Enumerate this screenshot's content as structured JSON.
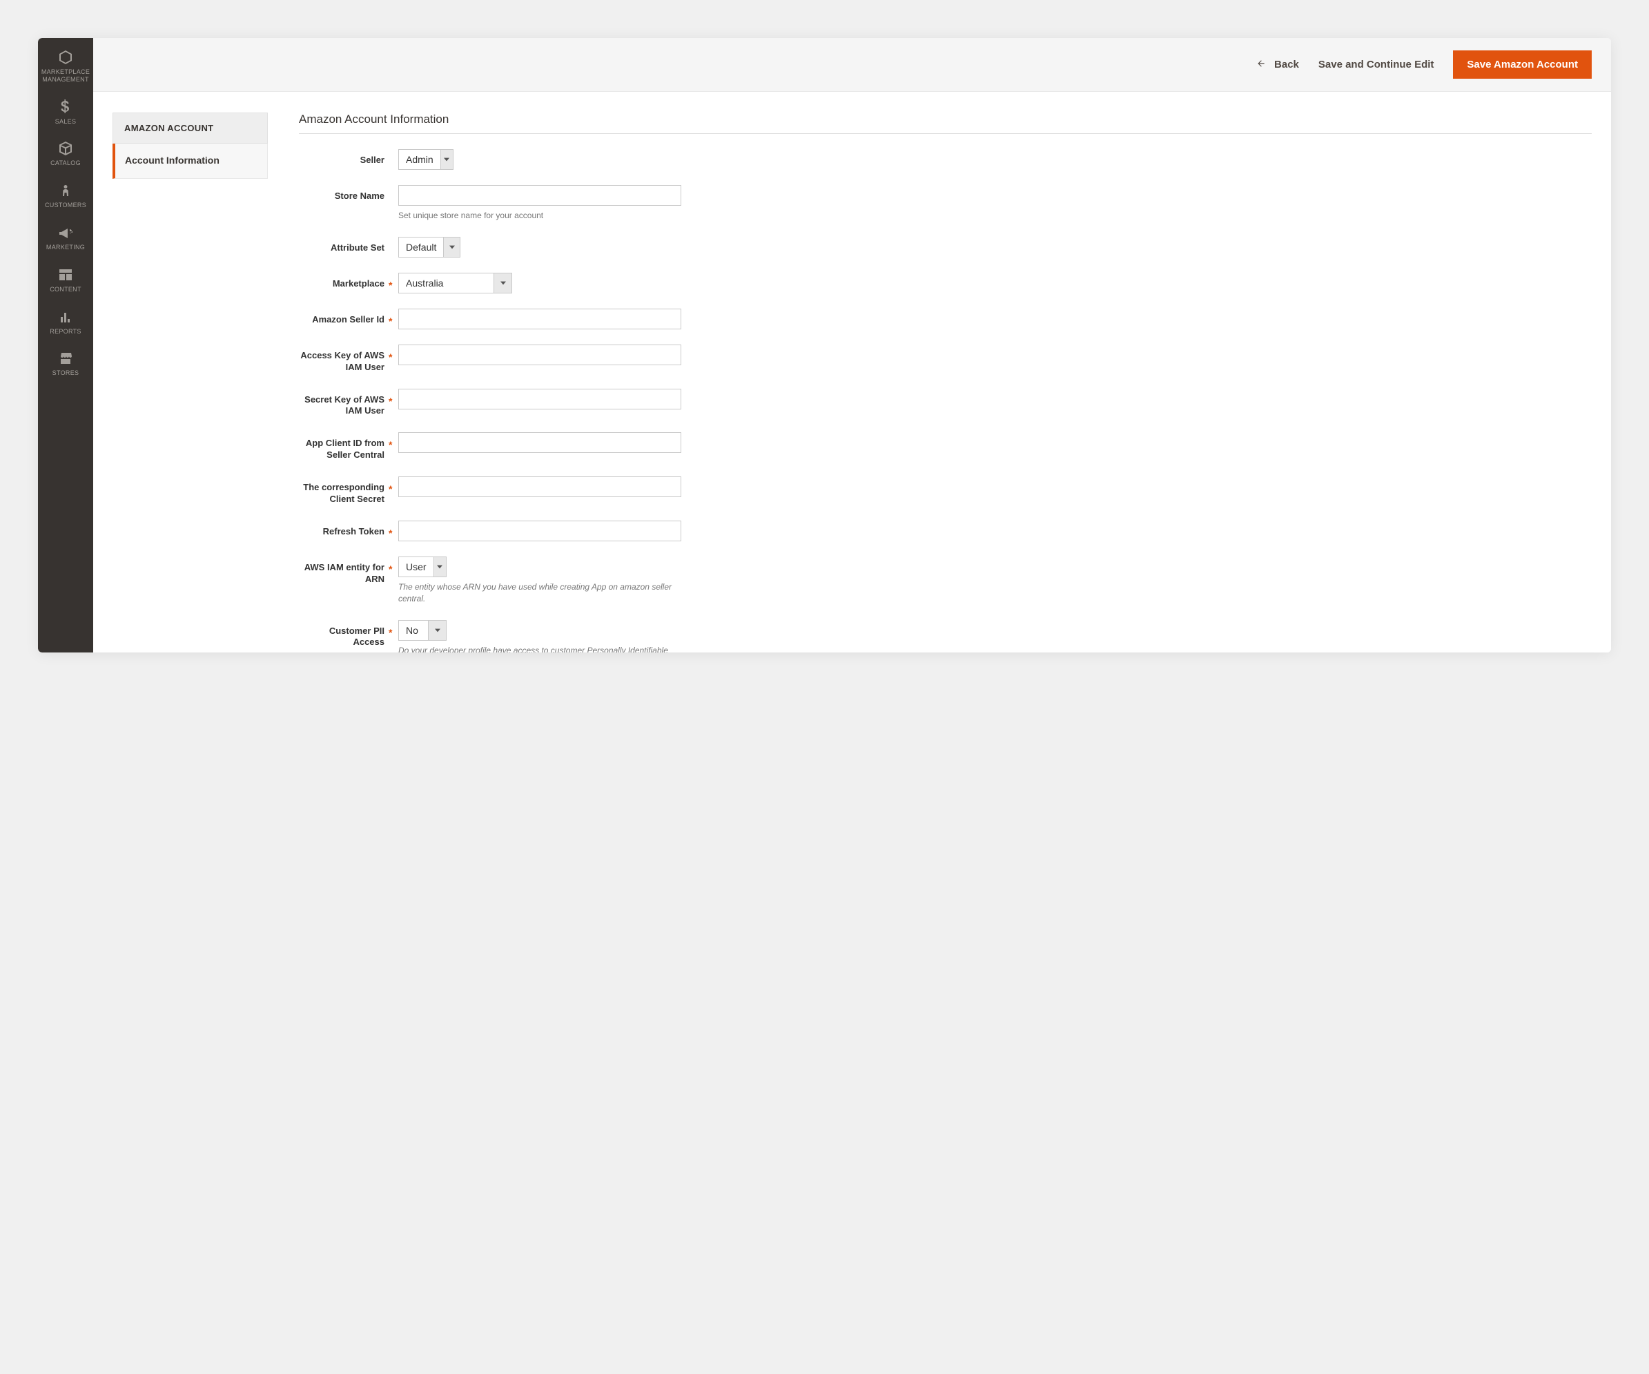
{
  "sidebar": {
    "items": [
      {
        "label": "MARKETPLACE MANAGEMENT",
        "icon": "hexagon-icon"
      },
      {
        "label": "SALES",
        "icon": "dollar-icon"
      },
      {
        "label": "CATALOG",
        "icon": "box-icon"
      },
      {
        "label": "CUSTOMERS",
        "icon": "person-icon"
      },
      {
        "label": "MARKETING",
        "icon": "megaphone-icon"
      },
      {
        "label": "CONTENT",
        "icon": "layout-icon"
      },
      {
        "label": "REPORTS",
        "icon": "bars-icon"
      },
      {
        "label": "STORES",
        "icon": "storefront-icon"
      }
    ]
  },
  "toolbar": {
    "back_label": "Back",
    "save_continue_label": "Save and Continue Edit",
    "save_label": "Save Amazon Account"
  },
  "sidepanel": {
    "header": "AMAZON ACCOUNT",
    "item": "Account Information"
  },
  "form": {
    "title": "Amazon Account Information",
    "fields": {
      "seller": {
        "label": "Seller",
        "value": "Admin",
        "required": false
      },
      "store_name": {
        "label": "Store Name",
        "value": "",
        "required": false,
        "hint": "Set unique store name for your account"
      },
      "attribute_set": {
        "label": "Attribute Set",
        "value": "Default",
        "required": false
      },
      "marketplace": {
        "label": "Marketplace",
        "value": "Australia",
        "required": true
      },
      "amazon_seller_id": {
        "label": "Amazon Seller Id",
        "value": "",
        "required": true
      },
      "access_key": {
        "label": "Access Key of AWS IAM User",
        "value": "",
        "required": true
      },
      "secret_key": {
        "label": "Secret Key of AWS IAM User",
        "value": "",
        "required": true
      },
      "app_client_id": {
        "label": "App Client ID from Seller Central",
        "value": "",
        "required": true
      },
      "client_secret": {
        "label": "The corresponding Client Secret",
        "value": "",
        "required": true
      },
      "refresh_token": {
        "label": "Refresh Token",
        "value": "",
        "required": true
      },
      "arn_entity": {
        "label": "AWS IAM entity for ARN",
        "value": "User",
        "required": true,
        "hint": "The entity whose ARN you have used while creating App on amazon seller central."
      },
      "pii_access": {
        "label": "Customer PII Access",
        "value": "No",
        "required": true,
        "hint": "Do your developer profile have access to customer Personally Identifiable Information?"
      }
    }
  }
}
